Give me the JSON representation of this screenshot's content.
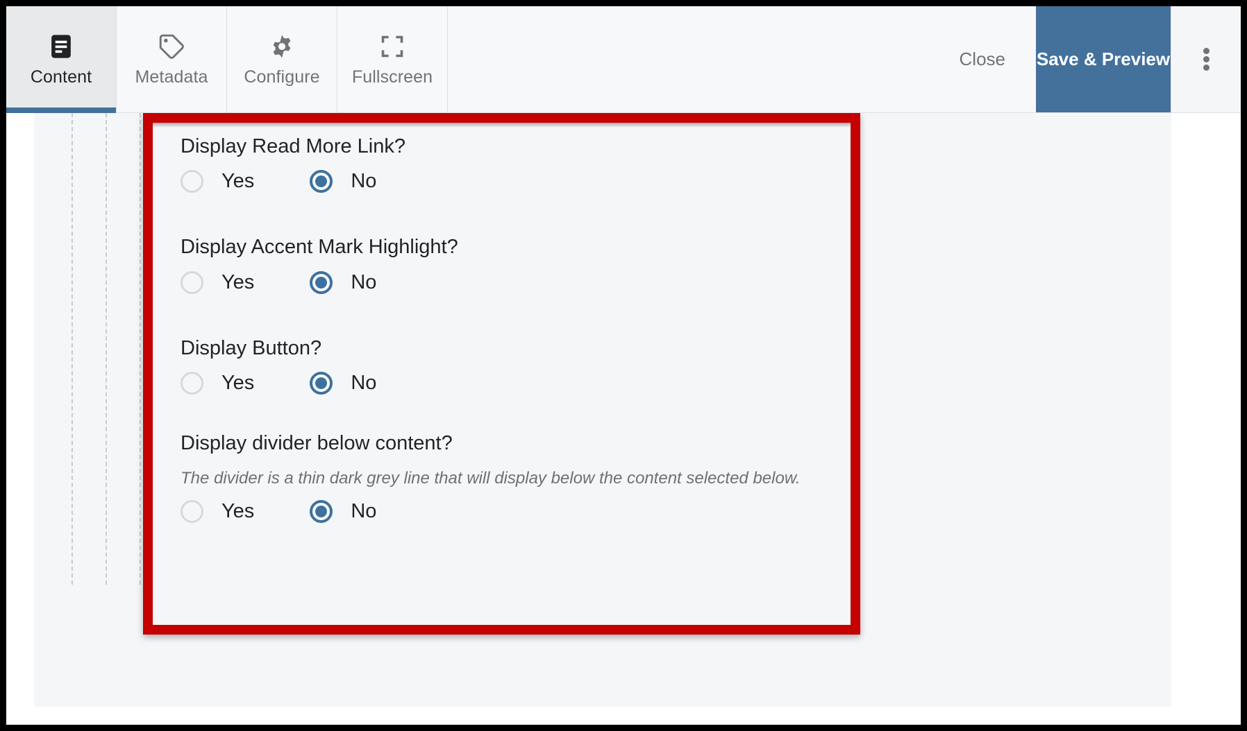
{
  "toolbar": {
    "tabs": [
      {
        "label": "Content",
        "icon": "content-document-icon",
        "active": true
      },
      {
        "label": "Metadata",
        "icon": "tag-icon",
        "active": false
      },
      {
        "label": "Configure",
        "icon": "gear-icon",
        "active": false
      },
      {
        "label": "Fullscreen",
        "icon": "fullscreen-expand-icon",
        "active": false
      }
    ],
    "close_label": "Close",
    "save_label": "Save & Preview",
    "overflow_icon": "kebab-menu-icon",
    "accent_color": "#43719c",
    "active_tab_bg": "#e7e9eb"
  },
  "highlight": {
    "border_color": "#c40000"
  },
  "form": {
    "fields": [
      {
        "label": "Display Read More Link?",
        "help": null,
        "options": [
          {
            "label": "Yes",
            "checked": false
          },
          {
            "label": "No",
            "checked": true
          }
        ]
      },
      {
        "label": "Display Accent Mark Highlight?",
        "help": null,
        "options": [
          {
            "label": "Yes",
            "checked": false
          },
          {
            "label": "No",
            "checked": true
          }
        ]
      },
      {
        "label": "Display Button?",
        "help": null,
        "options": [
          {
            "label": "Yes",
            "checked": false
          },
          {
            "label": "No",
            "checked": true
          }
        ]
      },
      {
        "label": "Display divider below content?",
        "help": "The divider is a thin dark grey line that will display below the content selected below.",
        "options": [
          {
            "label": "Yes",
            "checked": false
          },
          {
            "label": "No",
            "checked": true
          }
        ]
      }
    ],
    "radio_checked_color": "#3d719f",
    "radio_unchecked_color": "#d5dade"
  }
}
